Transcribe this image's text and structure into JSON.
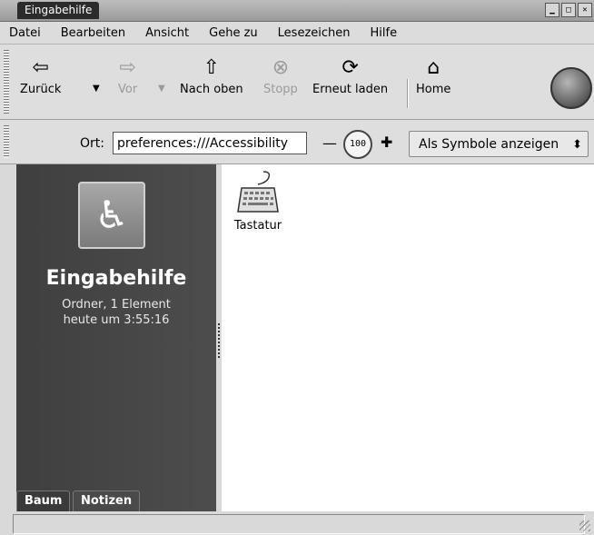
{
  "window": {
    "title": "Eingabehilfe"
  },
  "menu": [
    "Datei",
    "Bearbeiten",
    "Ansicht",
    "Gehe zu",
    "Lesezeichen",
    "Hilfe"
  ],
  "toolbar": {
    "back": "Zurück",
    "forward": "Vor",
    "up": "Nach oben",
    "stop": "Stopp",
    "reload": "Erneut laden",
    "home": "Home"
  },
  "location": {
    "label": "Ort:",
    "value": "preferences:///Accessibility",
    "zoom": "100",
    "view_mode": "Als Symbole anzeigen"
  },
  "sidebar": {
    "title": "Eingabehilfe",
    "info_line1": "Ordner, 1 Element",
    "info_line2": "heute um 3:55:16",
    "tabs": [
      "Baum",
      "Notizen"
    ]
  },
  "content": {
    "items": [
      {
        "label": "Tastatur",
        "icon": "keyboard-icon"
      }
    ]
  }
}
